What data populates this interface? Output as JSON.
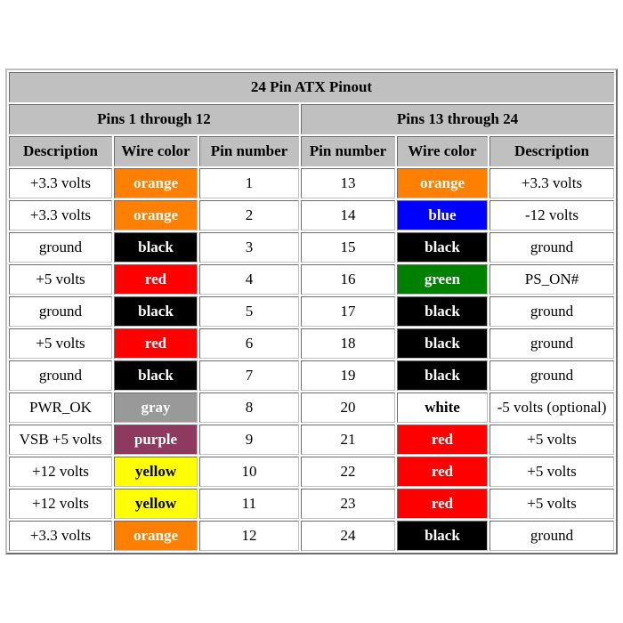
{
  "table": {
    "title": "24 Pin ATX Pinout",
    "groups": {
      "left": "Pins 1 through 12",
      "right": "Pins 13 through 24"
    },
    "columns": [
      "Description",
      "Wire color",
      "Pin number",
      "Pin number",
      "Wire color",
      "Description"
    ],
    "colors": {
      "header_bg": "#c0c0c0",
      "orange": "#ff7f00",
      "black": "#000000",
      "red": "#ff0000",
      "gray": "#999999",
      "purple": "#8e3a5e",
      "yellow": "#ffff00",
      "blue": "#0000ff",
      "green": "#008000",
      "white": "#ffffff"
    },
    "rows": [
      {
        "left_description": "+3.3 volts",
        "left_wire": "orange",
        "left_wire_bg": "#ff7f00",
        "left_wire_fg": "#ffffff",
        "left_pin": "1",
        "right_pin": "13",
        "right_wire": "orange",
        "right_wire_bg": "#ff7f00",
        "right_wire_fg": "#ffffff",
        "right_description": "+3.3 volts"
      },
      {
        "left_description": "+3.3 volts",
        "left_wire": "orange",
        "left_wire_bg": "#ff7f00",
        "left_wire_fg": "#ffffff",
        "left_pin": "2",
        "right_pin": "14",
        "right_wire": "blue",
        "right_wire_bg": "#0000ff",
        "right_wire_fg": "#ffffff",
        "right_description": "-12 volts"
      },
      {
        "left_description": "ground",
        "left_wire": "black",
        "left_wire_bg": "#000000",
        "left_wire_fg": "#ffffff",
        "left_pin": "3",
        "right_pin": "15",
        "right_wire": "black",
        "right_wire_bg": "#000000",
        "right_wire_fg": "#ffffff",
        "right_description": "ground"
      },
      {
        "left_description": "+5 volts",
        "left_wire": "red",
        "left_wire_bg": "#ff0000",
        "left_wire_fg": "#ffffff",
        "left_pin": "4",
        "right_pin": "16",
        "right_wire": "green",
        "right_wire_bg": "#008000",
        "right_wire_fg": "#ffffff",
        "right_description": "PS_ON#"
      },
      {
        "left_description": "ground",
        "left_wire": "black",
        "left_wire_bg": "#000000",
        "left_wire_fg": "#ffffff",
        "left_pin": "5",
        "right_pin": "17",
        "right_wire": "black",
        "right_wire_bg": "#000000",
        "right_wire_fg": "#ffffff",
        "right_description": "ground"
      },
      {
        "left_description": "+5 volts",
        "left_wire": "red",
        "left_wire_bg": "#ff0000",
        "left_wire_fg": "#ffffff",
        "left_pin": "6",
        "right_pin": "18",
        "right_wire": "black",
        "right_wire_bg": "#000000",
        "right_wire_fg": "#ffffff",
        "right_description": "ground"
      },
      {
        "left_description": "ground",
        "left_wire": "black",
        "left_wire_bg": "#000000",
        "left_wire_fg": "#ffffff",
        "left_pin": "7",
        "right_pin": "19",
        "right_wire": "black",
        "right_wire_bg": "#000000",
        "right_wire_fg": "#ffffff",
        "right_description": "ground"
      },
      {
        "left_description": "PWR_OK",
        "left_wire": "gray",
        "left_wire_bg": "#999999",
        "left_wire_fg": "#ffffff",
        "left_pin": "8",
        "right_pin": "20",
        "right_wire": "white",
        "right_wire_bg": "#ffffff",
        "right_wire_fg": "#000000",
        "right_description": "-5 volts (optional)"
      },
      {
        "left_description": "VSB +5 volts",
        "left_wire": "purple",
        "left_wire_bg": "#8e3a5e",
        "left_wire_fg": "#ffffff",
        "left_pin": "9",
        "right_pin": "21",
        "right_wire": "red",
        "right_wire_bg": "#ff0000",
        "right_wire_fg": "#ffffff",
        "right_description": "+5 volts"
      },
      {
        "left_description": "+12 volts",
        "left_wire": "yellow",
        "left_wire_bg": "#ffff00",
        "left_wire_fg": "#000000",
        "left_pin": "10",
        "right_pin": "22",
        "right_wire": "red",
        "right_wire_bg": "#ff0000",
        "right_wire_fg": "#ffffff",
        "right_description": "+5 volts"
      },
      {
        "left_description": "+12 volts",
        "left_wire": "yellow",
        "left_wire_bg": "#ffff00",
        "left_wire_fg": "#000000",
        "left_pin": "11",
        "right_pin": "23",
        "right_wire": "red",
        "right_wire_bg": "#ff0000",
        "right_wire_fg": "#ffffff",
        "right_description": "+5 volts"
      },
      {
        "left_description": "+3.3 volts",
        "left_wire": "orange",
        "left_wire_bg": "#ff7f00",
        "left_wire_fg": "#ffffff",
        "left_pin": "12",
        "right_pin": "24",
        "right_wire": "black",
        "right_wire_bg": "#000000",
        "right_wire_fg": "#ffffff",
        "right_description": "ground"
      }
    ]
  }
}
